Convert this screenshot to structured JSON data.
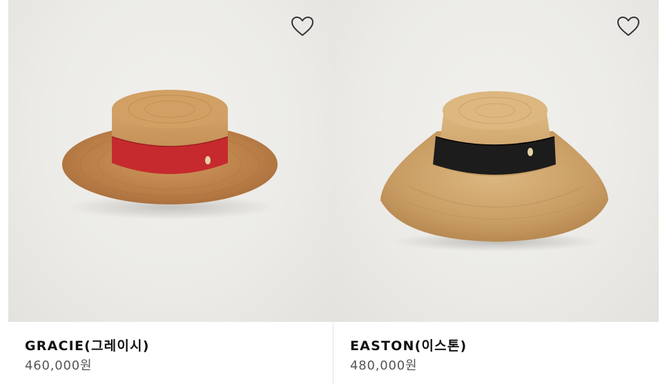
{
  "products": [
    {
      "name": "GRACIE(그레이시)",
      "price": "460,000원",
      "image_alt": "straw boater hat with red ribbon",
      "ribbon_color": "#c62a2e"
    },
    {
      "name": "EASTON(이스톤)",
      "price": "480,000원",
      "image_alt": "straw wide-brim hat with black ribbon",
      "ribbon_color": "#1c1c1c"
    }
  ],
  "wishlist_icon": "heart-outline-icon"
}
